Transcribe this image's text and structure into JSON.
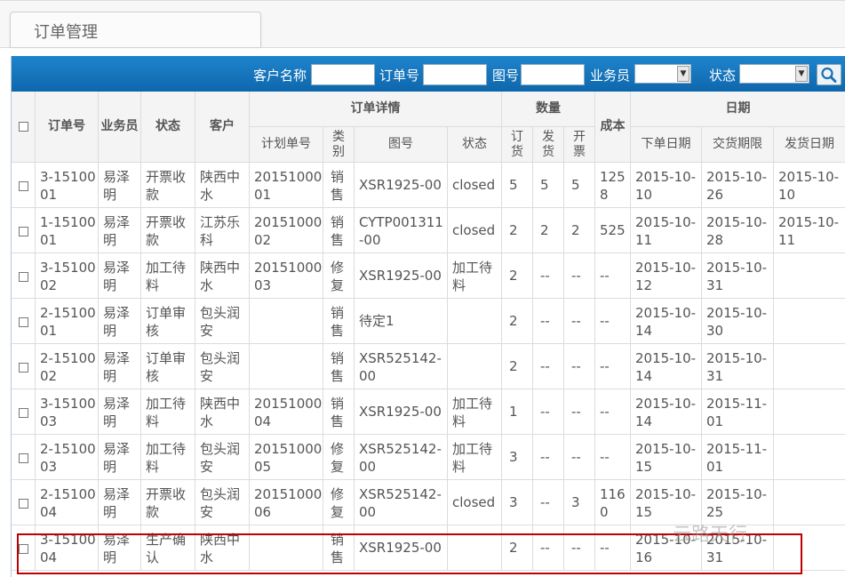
{
  "page": {
    "tab_title": "订单管理"
  },
  "search": {
    "customer_label": "客户名称",
    "order_no_label": "订单号",
    "drawing_no_label": "图号",
    "salesperson_label": "业务员",
    "status_label": "状态"
  },
  "table": {
    "headers": {
      "order_no": "订单号",
      "salesperson": "业务员",
      "status": "状态",
      "customer": "客户",
      "order_detail": "订单详情",
      "plan_no": "计划单号",
      "category": "类别",
      "drawing_no": "图号",
      "detail_status": "状态",
      "quantity": "数量",
      "ordered": "订货",
      "shipped": "发货",
      "invoiced": "开票",
      "cost": "成本",
      "date": "日期",
      "order_date": "下单日期",
      "due_date": "交货期限",
      "ship_date": "发货日期"
    },
    "rows": [
      {
        "order_no": "3-1510001",
        "salesperson": "易泽明",
        "status": "开票收款",
        "customer": "陕西中水",
        "plan_no": "2015100001",
        "category": "销售",
        "drawing_no": "XSR1925-00",
        "detail_status": "closed",
        "ordered": "5",
        "shipped": "5",
        "invoiced": "5",
        "cost": "1258",
        "order_date": "2015-10-10",
        "due_date": "2015-10-26",
        "ship_date": "2015-10-10"
      },
      {
        "order_no": "1-1510001",
        "salesperson": "易泽明",
        "status": "开票收款",
        "customer": "江苏乐科",
        "plan_no": "2015100002",
        "category": "销售",
        "drawing_no": "CYTP001311-00",
        "detail_status": "closed",
        "ordered": "2",
        "shipped": "2",
        "invoiced": "2",
        "cost": "525",
        "order_date": "2015-10-11",
        "due_date": "2015-10-28",
        "ship_date": "2015-10-11"
      },
      {
        "order_no": "3-1510002",
        "salesperson": "易泽明",
        "status": "加工待料",
        "customer": "陕西中水",
        "plan_no": "2015100003",
        "category": "修复",
        "drawing_no": "XSR1925-00",
        "detail_status": "加工待料",
        "ordered": "2",
        "shipped": "--",
        "invoiced": "--",
        "cost": "--",
        "order_date": "2015-10-12",
        "due_date": "2015-10-31",
        "ship_date": ""
      },
      {
        "order_no": "2-1510001",
        "salesperson": "易泽明",
        "status": "订单审核",
        "customer": "包头润安",
        "plan_no": "",
        "category": "销售",
        "drawing_no": "待定1",
        "detail_status": "",
        "ordered": "2",
        "shipped": "--",
        "invoiced": "--",
        "cost": "--",
        "order_date": "2015-10-14",
        "due_date": "2015-10-30",
        "ship_date": ""
      },
      {
        "order_no": "2-1510002",
        "salesperson": "易泽明",
        "status": "订单审核",
        "customer": "包头润安",
        "plan_no": "",
        "category": "销售",
        "drawing_no": "XSR525142-00",
        "detail_status": "",
        "ordered": "2",
        "shipped": "--",
        "invoiced": "--",
        "cost": "--",
        "order_date": "2015-10-14",
        "due_date": "2015-10-31",
        "ship_date": ""
      },
      {
        "order_no": "3-1510003",
        "salesperson": "易泽明",
        "status": "加工待料",
        "customer": "陕西中水",
        "plan_no": "2015100004",
        "category": "销售",
        "drawing_no": "XSR1925-00",
        "detail_status": "加工待料",
        "ordered": "1",
        "shipped": "--",
        "invoiced": "--",
        "cost": "--",
        "order_date": "2015-10-14",
        "due_date": "2015-11-01",
        "ship_date": ""
      },
      {
        "order_no": "2-1510003",
        "salesperson": "易泽明",
        "status": "加工待料",
        "customer": "包头润安",
        "plan_no": "2015100005",
        "category": "修复",
        "drawing_no": "XSR525142-00",
        "detail_status": "加工待料",
        "ordered": "3",
        "shipped": "--",
        "invoiced": "--",
        "cost": "--",
        "order_date": "2015-10-15",
        "due_date": "2015-11-01",
        "ship_date": ""
      },
      {
        "order_no": "2-1510004",
        "salesperson": "易泽明",
        "status": "开票收款",
        "customer": "包头润安",
        "plan_no": "2015100006",
        "category": "修复",
        "drawing_no": "XSR525142-00",
        "detail_status": "closed",
        "ordered": "3",
        "shipped": "--",
        "invoiced": "3",
        "cost": "1160",
        "order_date": "2015-10-15",
        "due_date": "2015-10-25",
        "ship_date": ""
      },
      {
        "order_no": "3-1510004",
        "salesperson": "易泽明",
        "status": "生产确认",
        "customer": "陕西中水",
        "plan_no": "",
        "category": "销售",
        "drawing_no": "XSR1925-00",
        "detail_status": "",
        "ordered": "2",
        "shipped": "--",
        "invoiced": "--",
        "cost": "--",
        "order_date": "2015-10-16",
        "due_date": "2015-10-31",
        "ship_date": ""
      }
    ]
  },
  "watermark": "云路天行",
  "colors": {
    "toolbar": "#1a7cc4",
    "highlight_box": "#c00000"
  }
}
